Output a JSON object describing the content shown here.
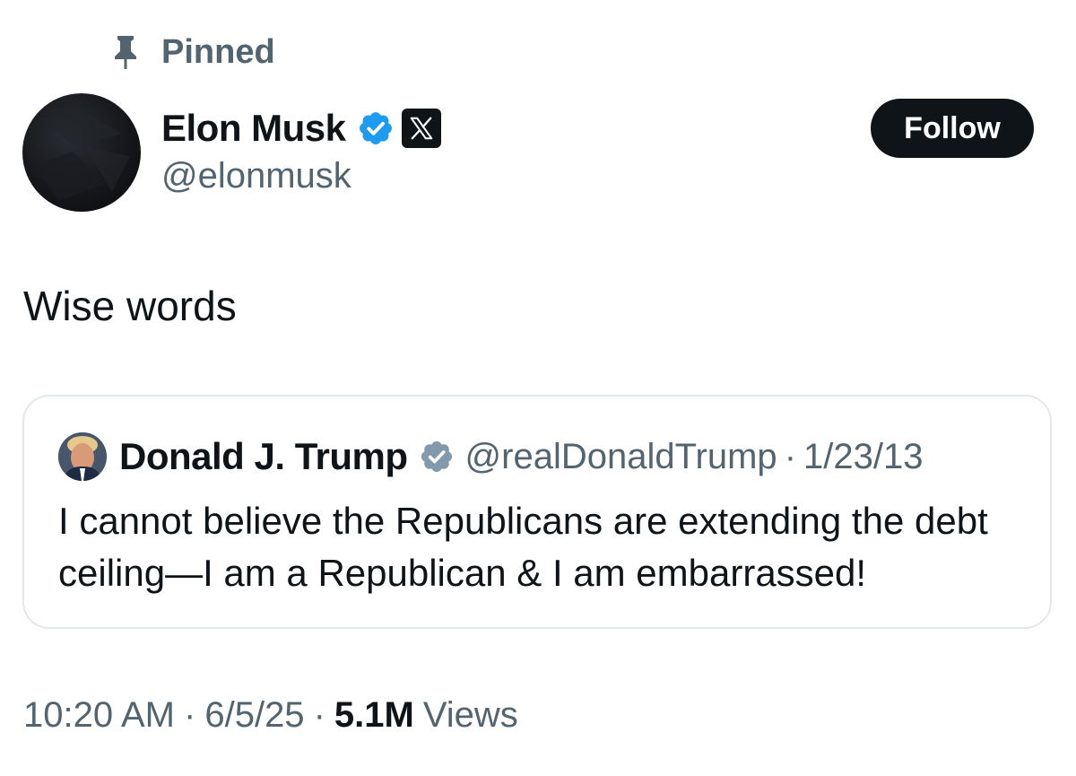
{
  "pinned": {
    "label": "Pinned",
    "icon": "pin-icon"
  },
  "author": {
    "name": "Elon Musk",
    "handle": "@elonmusk",
    "verified_icon": "verified-icon",
    "affiliation_icon": "x-logo-icon"
  },
  "follow_label": "Follow",
  "tweet": {
    "text": "Wise words"
  },
  "quote": {
    "name": "Donald J. Trump",
    "handle": "@realDonaldTrump",
    "separator": "·",
    "date": "1/23/13",
    "text": "I cannot believe the Republicans are extending the debt ceiling—I am a Republican & I am embarrassed!"
  },
  "meta": {
    "time": "10:20 AM",
    "separator": "·",
    "date": "6/5/25",
    "views_count": "5.1M",
    "views_label": "Views"
  },
  "colors": {
    "text_primary": "#0f1419",
    "text_secondary": "#536471",
    "verified_blue": "#1d9bf0",
    "verified_grey": "#829aab",
    "border": "#e4e8eb"
  }
}
